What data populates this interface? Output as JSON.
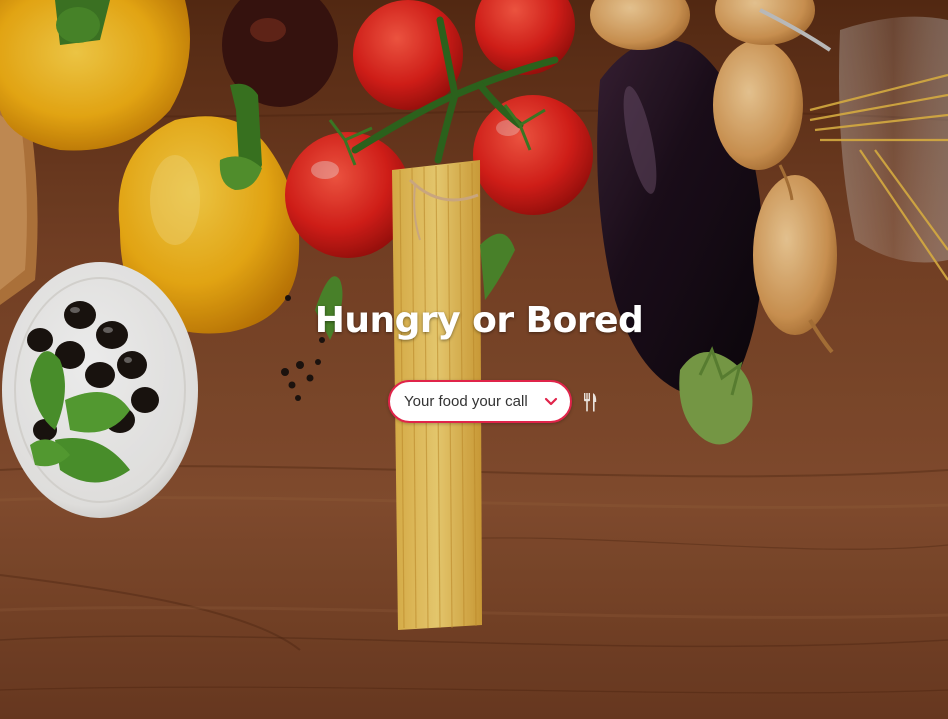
{
  "hero": {
    "title": "Hungry or Bored"
  },
  "selector": {
    "selected": "Your food your call"
  },
  "icons": {
    "dropdown": "chevron-down-icon",
    "submit": "fork-knife-icon"
  },
  "colors": {
    "accent": "#e0244a",
    "title": "#ffffff",
    "select_bg": "#ffffff",
    "select_text": "#333333",
    "table_wood": "#7a4426"
  }
}
